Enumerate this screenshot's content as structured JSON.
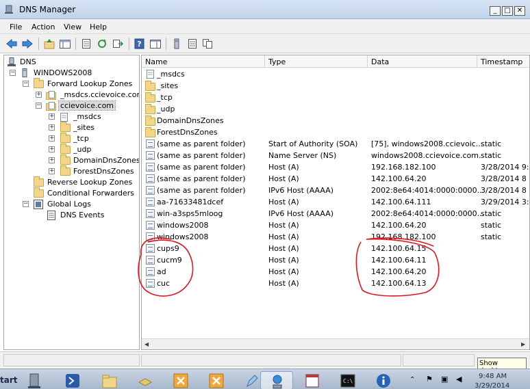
{
  "window": {
    "title": "DNS Manager"
  },
  "menu": [
    {
      "label": "File"
    },
    {
      "label": "Action"
    },
    {
      "label": "View"
    },
    {
      "label": "Help"
    }
  ],
  "tree": {
    "root": "DNS",
    "server": "WINDOWS2008",
    "forward": "Forward Lookup Zones",
    "zone1": "_msdcs.ccievoice.com",
    "zone2": "ccievoice.com",
    "children": [
      "_msdcs",
      "_sites",
      "_tcp",
      "_udp",
      "DomainDnsZones",
      "ForestDnsZones"
    ],
    "reverse": "Reverse Lookup Zones",
    "conditional": "Conditional Forwarders",
    "global_logs": "Global Logs",
    "dns_events": "DNS Events"
  },
  "columns": {
    "name": "Name",
    "type": "Type",
    "data": "Data",
    "timestamp": "Timestamp"
  },
  "folders": [
    "_msdcs",
    "_sites",
    "_tcp",
    "_udp",
    "DomainDnsZones",
    "ForestDnsZones"
  ],
  "records": [
    {
      "name": "(same as parent folder)",
      "type": "Start of Authority (SOA)",
      "data": "[75], windows2008.ccievoic...",
      "timestamp": "static"
    },
    {
      "name": "(same as parent folder)",
      "type": "Name Server (NS)",
      "data": "windows2008.ccievoice.com.",
      "timestamp": "static"
    },
    {
      "name": "(same as parent folder)",
      "type": "Host (A)",
      "data": "192.168.182.100",
      "timestamp": "3/28/2014 9:"
    },
    {
      "name": "(same as parent folder)",
      "type": "Host (A)",
      "data": "142.100.64.20",
      "timestamp": "3/28/2014 8"
    },
    {
      "name": "(same as parent folder)",
      "type": "IPv6 Host (AAAA)",
      "data": "2002:8e64:4014:0000:0000...",
      "timestamp": "3/28/2014 8"
    },
    {
      "name": "aa-71633481dcef",
      "type": "Host (A)",
      "data": "142.100.64.111",
      "timestamp": "3/29/2014 3:"
    },
    {
      "name": "win-a3sps5mloog",
      "type": "IPv6 Host (AAAA)",
      "data": "2002:8e64:4014:0000:0000...",
      "timestamp": "static"
    },
    {
      "name": "windows2008",
      "type": "Host (A)",
      "data": "142.100.64.20",
      "timestamp": "static"
    },
    {
      "name": "windows2008",
      "type": "Host (A)",
      "data": "192.168.182.100",
      "timestamp": "static"
    },
    {
      "name": "cups9",
      "type": "Host (A)",
      "data": "142.100.64.15",
      "timestamp": ""
    },
    {
      "name": "cucm9",
      "type": "Host (A)",
      "data": "142.100.64.11",
      "timestamp": ""
    },
    {
      "name": "ad",
      "type": "Host (A)",
      "data": "142.100.64.20",
      "timestamp": ""
    },
    {
      "name": "cuc",
      "type": "Host (A)",
      "data": "142.100.64.13",
      "timestamp": ""
    }
  ],
  "taskbar": {
    "start": "tart",
    "time": "9:48 AM",
    "date": "3/29/2014",
    "tooltip": "Show desktop"
  },
  "colors": {
    "annotation": "#e0141e",
    "title_bar": "#c8d9ee",
    "selection": "#dadada"
  }
}
